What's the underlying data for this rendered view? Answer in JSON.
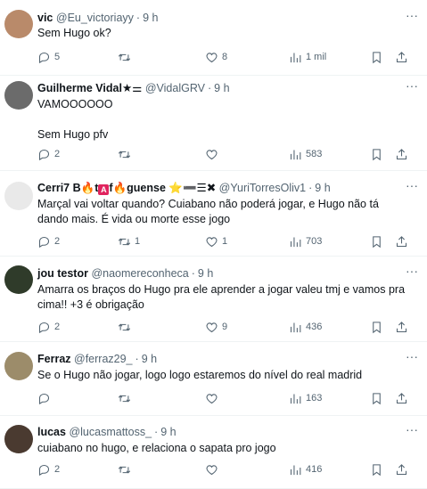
{
  "tweets": [
    {
      "name": "vic",
      "handle": "@Eu_victoriayy",
      "time": "9 h",
      "text": "Sem Hugo ok?",
      "replies": "5",
      "retweets": "",
      "likes": "8",
      "views": "1 mil",
      "avatar_color": "#b98a6a"
    },
    {
      "name": "Guilherme Vidal★⚌",
      "handle": "@VidalGRV",
      "time": "9 h",
      "text": "VAMOOOOOO\n\nSem Hugo pfv",
      "replies": "2",
      "retweets": "",
      "likes": "",
      "views": "583",
      "avatar_color": "#6b6b6b"
    },
    {
      "name_parts": [
        "Cerri7 B",
        "🔥",
        "t",
        "A",
        "f",
        "🔥",
        "guense ⭐➖☰✖"
      ],
      "handle": "@YuriTorresOliv1",
      "time": "9 h",
      "text": "Marçal vai voltar quando? Cuiabano não poderá jogar, e Hugo não tá dando mais. É vida ou morte esse jogo",
      "replies": "2",
      "retweets": "1",
      "likes": "1",
      "views": "703",
      "avatar_color": "#e9e9e9"
    },
    {
      "name": "jou testor",
      "handle": "@naomereconheca",
      "time": "9 h",
      "text": "Amarra os braços do Hugo pra ele aprender a jogar valeu tmj e vamos pra cima!! +3 é obrigação",
      "replies": "2",
      "retweets": "",
      "likes": "9",
      "views": "436",
      "avatar_color": "#2f3b2a"
    },
    {
      "name": "Ferraz",
      "handle": "@ferraz29_",
      "time": "9 h",
      "text": "Se o Hugo não jogar, logo logo estaremos do nível do real madrid",
      "replies": "",
      "retweets": "",
      "likes": "",
      "views": "163",
      "avatar_color": "#9c8c6a"
    },
    {
      "name": "lucas",
      "handle": "@lucasmattoss_",
      "time": "9 h",
      "text": "cuiabano no hugo, e relaciona o sapata pro jogo",
      "replies": "2",
      "retweets": "",
      "likes": "",
      "views": "416",
      "avatar_color": "#4a3a30"
    }
  ],
  "icons": {
    "reply": "reply-icon",
    "retweet": "retweet-icon",
    "like": "heart-icon",
    "views": "views-icon",
    "bookmark": "bookmark-icon",
    "share": "share-icon",
    "more": "more-icon"
  },
  "colors": {
    "secondary_text": "#536471",
    "divider": "#eff3f4"
  }
}
